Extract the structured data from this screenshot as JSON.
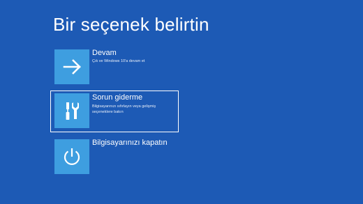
{
  "page": {
    "title": "Bir seçenek belirtin"
  },
  "options": [
    {
      "title": "Devam",
      "description": "Çık ve Windows 10'a devam et",
      "icon": "arrow-right-icon",
      "selected": false
    },
    {
      "title": "Sorun giderme",
      "description": "Bilgisayarınızı sıfırlayın veya gelişmiş seçeneklere bakın",
      "icon": "tools-icon",
      "selected": true
    },
    {
      "title": "Bilgisayarınızı kapatın",
      "description": "",
      "icon": "power-icon",
      "selected": false
    }
  ],
  "colors": {
    "background": "#1d5ab5",
    "tile": "#3e9ee0",
    "text": "#ffffff",
    "selection_border": "#ffffff"
  }
}
